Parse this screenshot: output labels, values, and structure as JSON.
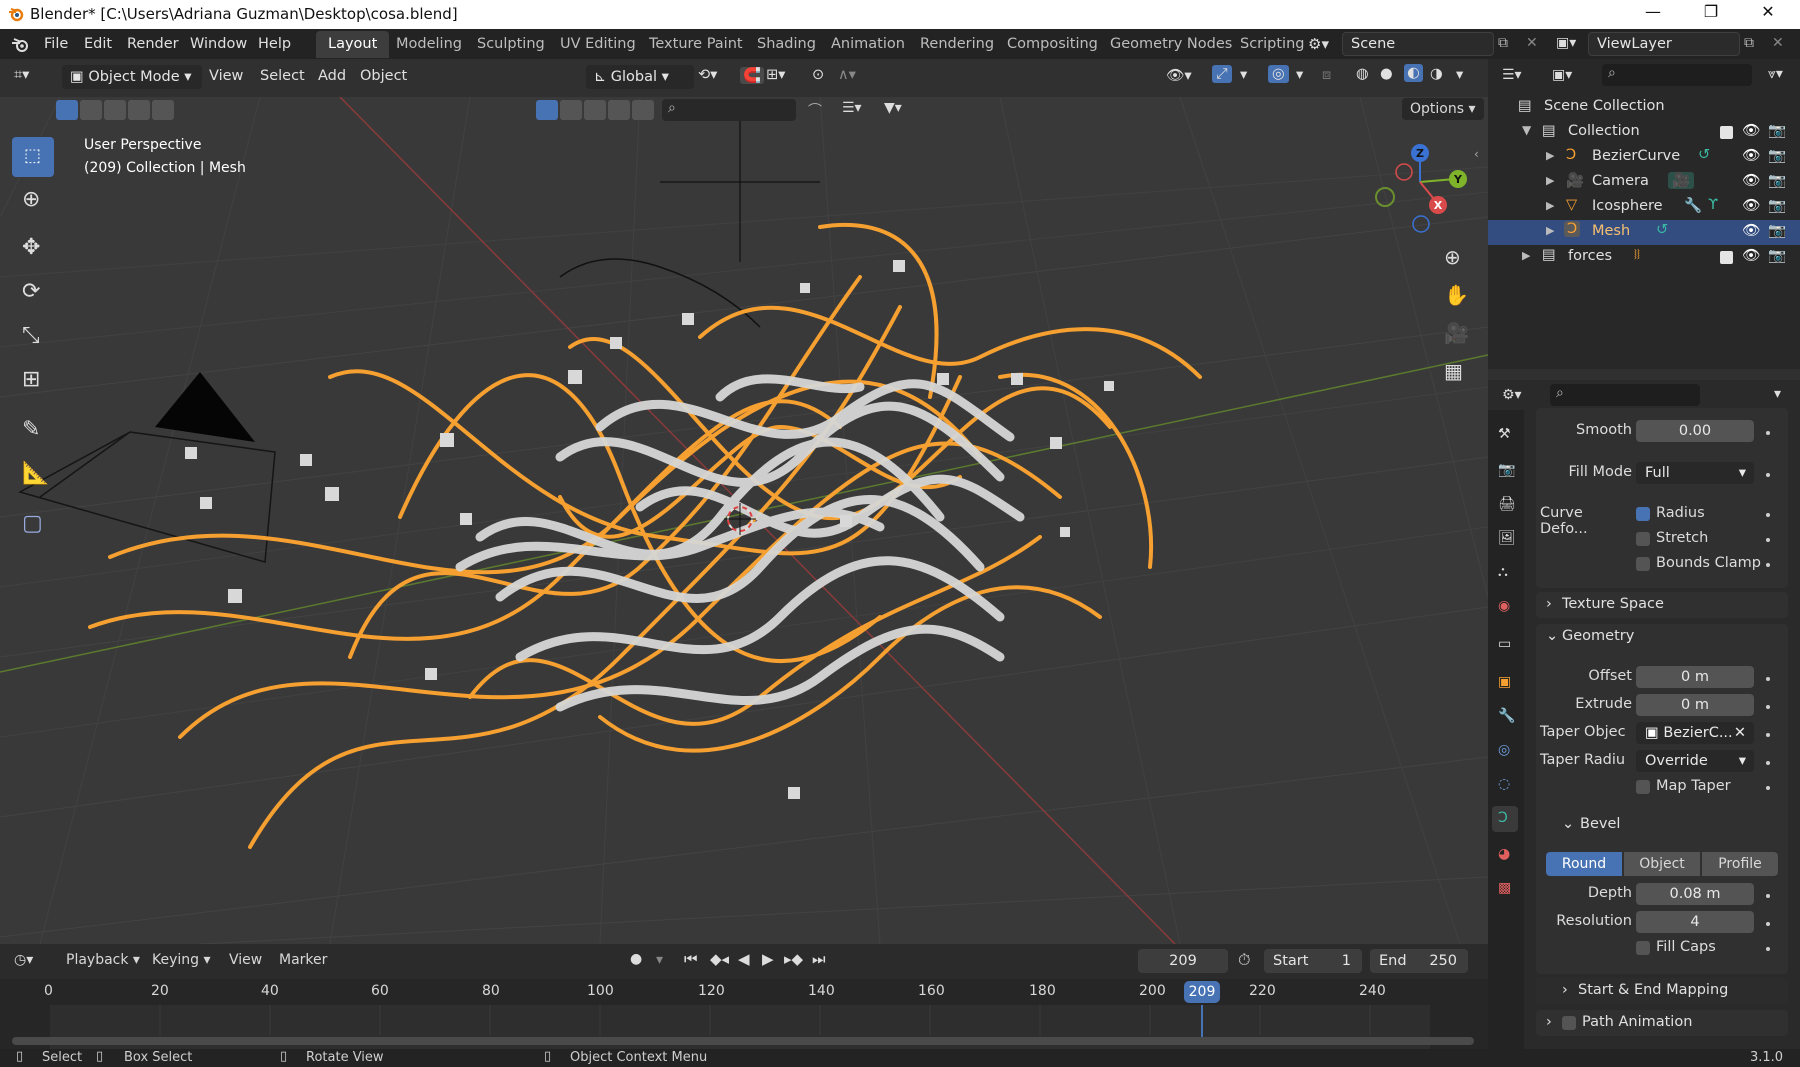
{
  "window": {
    "title": "Blender* [C:\\Users\\Adriana Guzman\\Desktop\\cosa.blend]",
    "min": "—",
    "max": "❐",
    "close": "✕"
  },
  "menu": [
    "File",
    "Edit",
    "Render",
    "Window",
    "Help"
  ],
  "workspaces": [
    "Layout",
    "Modeling",
    "Sculpting",
    "UV Editing",
    "Texture Paint",
    "Shading",
    "Animation",
    "Rendering",
    "Compositing",
    "Geometry Nodes",
    "Scripting"
  ],
  "scene": {
    "name": "Scene",
    "view_layer": "ViewLayer"
  },
  "viewport_header": {
    "mode": "Object Mode",
    "menus": [
      "View",
      "Select",
      "Add",
      "Object"
    ],
    "orientation": "Global",
    "options": "Options"
  },
  "viewport": {
    "view_name": "User Perspective",
    "info": "(209) Collection | Mesh",
    "gizmo": {
      "x": "X",
      "y": "Y",
      "z": "Z"
    }
  },
  "outliner": {
    "root": "Scene Collection",
    "collection": "Collection",
    "items": [
      "BezierCurve",
      "Camera",
      "Icosphere",
      "Mesh"
    ],
    "forces": "forces",
    "selected": "Mesh"
  },
  "properties": {
    "smooth_label": "Smooth",
    "smooth_value": "0.00",
    "fill_mode_label": "Fill Mode",
    "fill_mode_value": "Full",
    "curve_deform_label": "Curve Defo...",
    "radius": "Radius",
    "stretch": "Stretch",
    "bounds_clamp": "Bounds Clamp",
    "texture_space": "Texture Space",
    "geometry": "Geometry",
    "offset_label": "Offset",
    "offset_value": "0 m",
    "extrude_label": "Extrude",
    "extrude_value": "0 m",
    "taper_object_label": "Taper Objec",
    "taper_object_value": "BezierC...",
    "taper_radius_label": "Taper Radiu",
    "taper_radius_value": "Override",
    "map_taper": "Map Taper",
    "bevel": "Bevel",
    "bevel_modes": [
      "Round",
      "Object",
      "Profile"
    ],
    "depth_label": "Depth",
    "depth_value": "0.08 m",
    "resolution_label": "Resolution",
    "resolution_value": "4",
    "fill_caps": "Fill Caps",
    "start_end_mapping": "Start & End Mapping",
    "path_animation": "Path Animation"
  },
  "timeline": {
    "menus": [
      "Playback",
      "Keying",
      "View",
      "Marker"
    ],
    "current_frame": "209",
    "start_label": "Start",
    "start_value": "1",
    "end_label": "End",
    "end_value": "250",
    "ticks": [
      "0",
      "20",
      "40",
      "60",
      "80",
      "100",
      "120",
      "140",
      "160",
      "180",
      "200",
      "220",
      "240"
    ]
  },
  "status": {
    "select": "Select",
    "box_select": "Box Select",
    "rotate_view": "Rotate View",
    "context_menu": "Object Context Menu",
    "version": "3.1.0"
  },
  "colors": {
    "accent": "#4772b3",
    "selection_orange": "#f5a031",
    "outliner_selected": "#334d80"
  }
}
